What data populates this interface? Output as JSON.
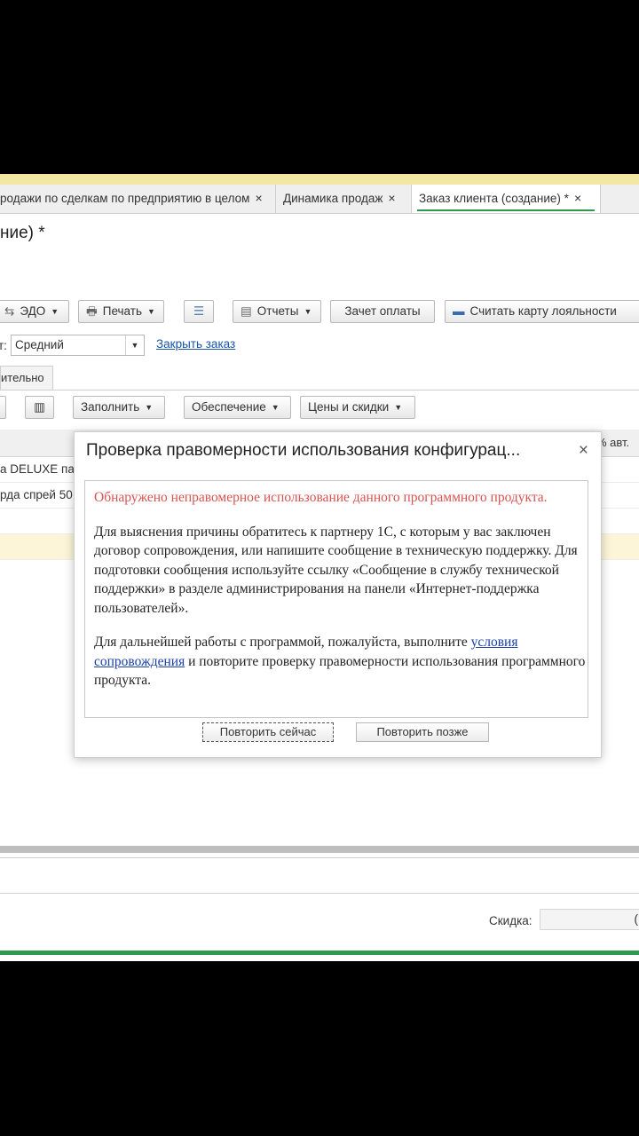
{
  "tabs": [
    {
      "label": "родажи по сделкам по предприятию в целом",
      "close": "×"
    },
    {
      "label": "Динамика продаж",
      "close": "×"
    },
    {
      "label": "Заказ клиента (создание) *",
      "close": "×"
    }
  ],
  "form_title": "ние) *",
  "toolbar": {
    "edo": "ЭДО",
    "print": "Печать",
    "reports": "Отчеты",
    "offset": "Зачет оплаты",
    "loyalty": "Считать карту лояльности"
  },
  "priority": {
    "label": "т:",
    "value": "Средний",
    "close_link": "Закрыть заказ"
  },
  "page_tab": "ительно",
  "table_toolbar": {
    "fill": "Заполнить",
    "provision": "Обеспечение",
    "prices": "Цены и скидки"
  },
  "grid": {
    "col_header": "% авт.",
    "rows": [
      "а DELUXE па",
      "рда спрей 50"
    ]
  },
  "footer": {
    "discount_label": "Скидка:",
    "discount_value": "("
  },
  "dialog": {
    "title": "Проверка правомерности использования конфигурац...",
    "close": "×",
    "error": "Обнаружено неправомерное использование данного программного продукта.",
    "para2": "Для выяснения причины обратитесь к партнеру 1С, с которым у вас заключен договор сопровождения, или напишите сообщение в техническую поддержку. Для подготовки сообщения используйте ссылку «Сообщение в службу технической поддержки» в разделе администрирования на панели «Интернет-поддержка пользователей».",
    "para3_before": "Для дальнейшей работы с программой, пожалуйста, выполните ",
    "para3_link": "условия сопровождения",
    "para3_after": " и повторите проверку правомерности использования программного продукта.",
    "retry_now": "Повторить сейчас",
    "retry_later": "Повторить позже"
  },
  "colors": {
    "accent_green": "#2f9a4e",
    "error_red": "#d9534f",
    "link_blue": "#1a55a8"
  }
}
